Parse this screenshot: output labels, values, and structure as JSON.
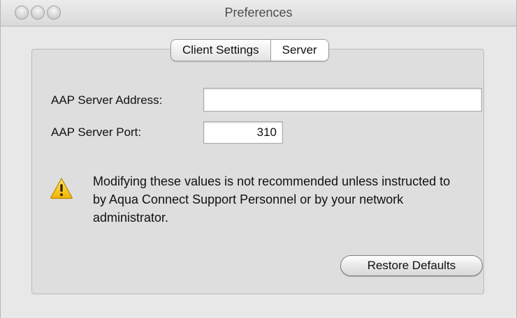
{
  "window": {
    "title": "Preferences"
  },
  "tabs": [
    {
      "label": "Client Settings",
      "selected": false
    },
    {
      "label": "Server",
      "selected": true
    }
  ],
  "form": {
    "server_address": {
      "label": "AAP Server Address:",
      "value": ""
    },
    "server_port": {
      "label": "AAP Server Port:",
      "value": "310"
    }
  },
  "warning": {
    "icon": "warning-triangle-icon",
    "text": "Modifying these values is not recommended unless instructed to by Aqua Connect Support Personnel or by your network administrator."
  },
  "buttons": {
    "restore_defaults": "Restore Defaults"
  },
  "colors": {
    "warning_yellow": "#f5c400",
    "window_bg": "#e8e8e8"
  }
}
